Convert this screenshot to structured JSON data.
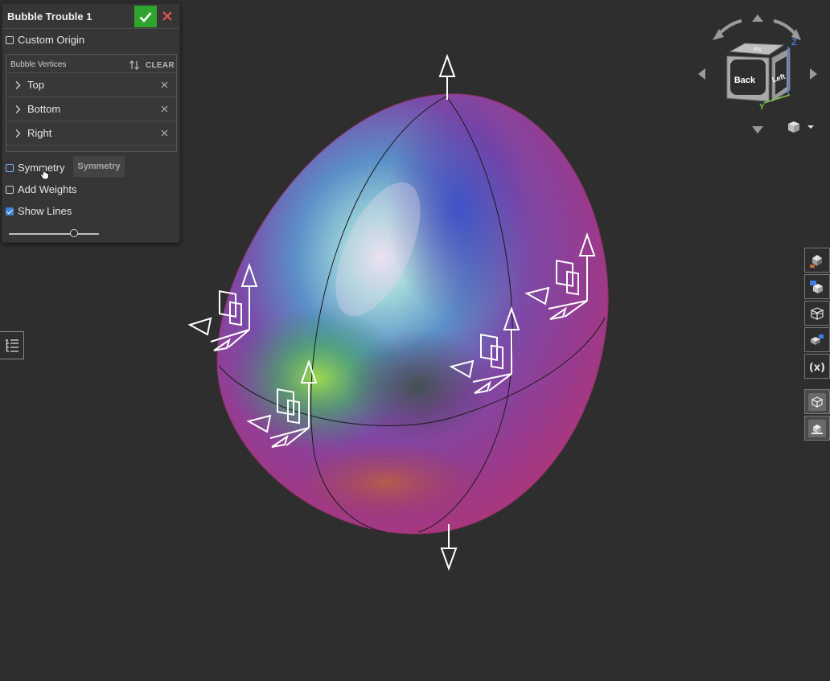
{
  "dialog": {
    "title": "Bubble Trouble 1",
    "custom_origin_label": "Custom Origin",
    "custom_origin_checked": false,
    "list_header": "Bubble Vertices",
    "clear_label": "CLEAR",
    "vertices": [
      {
        "label": "Top"
      },
      {
        "label": "Bottom"
      },
      {
        "label": "Right"
      }
    ],
    "symmetry_label": "Symmetry",
    "symmetry_checked": false,
    "symmetry_button": "Symmetry",
    "add_weights_label": "Add Weights",
    "add_weights_checked": false,
    "show_lines_label": "Show Lines",
    "show_lines_checked": true,
    "slider_value": 0.72
  },
  "viewcube": {
    "front_face": "Back",
    "side_face": "Left",
    "top_face": "Top",
    "axis_z": "Z",
    "axis_y": "Y"
  },
  "colors": {
    "accept": "#2fa530",
    "cancel": "#e05757",
    "checkbox_checked": "#3b82d6",
    "axis_z": "#3f7fe0",
    "axis_y": "#7fc842"
  },
  "toolbar_icons": [
    "render-mode-icon",
    "view-cube-icon",
    "section-view-icon",
    "display-states-icon",
    "variables-icon",
    "named-views-icon",
    "appearance-icon"
  ]
}
